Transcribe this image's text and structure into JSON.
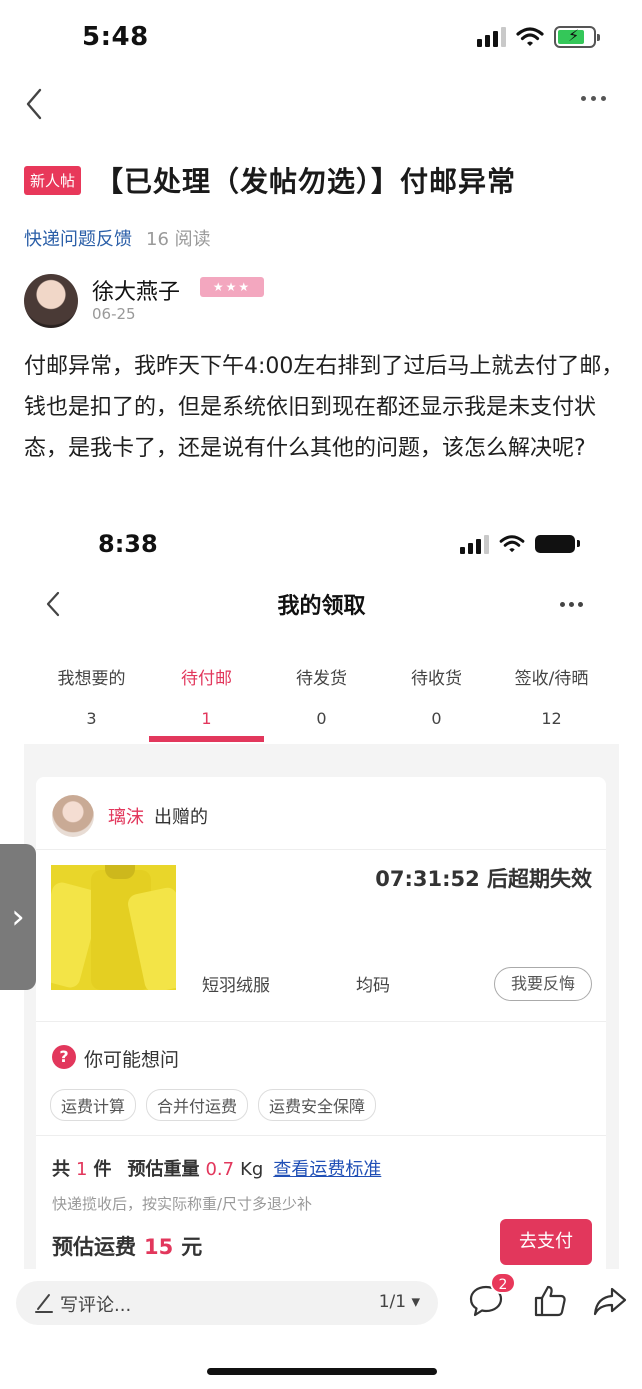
{
  "status_bar": {
    "time": "5:48"
  },
  "post": {
    "badge": "新人帖",
    "title": "【已处理（发帖勿选）】付邮异常",
    "category": "快递问题反馈",
    "reads": "16 阅读",
    "author": {
      "name": "徐大燕子",
      "level_stars": "★★★",
      "date": "06-25"
    },
    "body": "付邮异常，我昨天下午4:00左右排到了过后马上就去付了邮，钱也是扣了的，但是系统依旧到现在都还显示我是未支付状态，是我卡了，还是说有什么其他的问题，该怎么解决呢?"
  },
  "screenshot": {
    "time": "8:38",
    "title": "我的领取",
    "tabs": [
      {
        "label": "我想要的",
        "count": "3"
      },
      {
        "label": "待付邮",
        "count": "1"
      },
      {
        "label": "待发货",
        "count": "0"
      },
      {
        "label": "待收货",
        "count": "0"
      },
      {
        "label": "签收/待晒",
        "count": "12"
      }
    ],
    "giver": {
      "name": "璃沫",
      "suffix": "出赠的"
    },
    "countdown": "07:31:52 后超期失效",
    "spec_item": "短羽绒服",
    "spec_size": "均码",
    "regret_button": "我要反悔",
    "faq_title": "你可能想问",
    "faq_chips": [
      "运费计算",
      "合并付运费",
      "运费安全保障"
    ],
    "summary": {
      "count_prefix": "共",
      "count": "1",
      "count_unit": "件",
      "weight_label": "预估重量",
      "weight": "0.7",
      "weight_unit": "Kg",
      "link": "查看运费标准"
    },
    "note": "快递揽收后，按实际称重/尺寸多退少补",
    "fee": {
      "label": "预估运费",
      "amount": "15",
      "unit": "元"
    },
    "pay_button": "去支付",
    "accent_color": "#e2375c"
  },
  "bottom_bar": {
    "comment_placeholder": "写评论...",
    "page_indicator": "1/1",
    "comment_badge": "2"
  }
}
